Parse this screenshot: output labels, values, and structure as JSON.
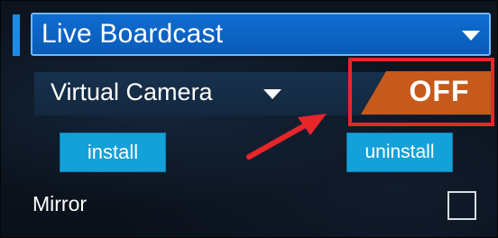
{
  "header": {
    "title": "Live Boardcast",
    "dropdown_icon": "chevron-down-icon"
  },
  "virtual_camera": {
    "label": "Virtual Camera",
    "dropdown_icon": "chevron-down-icon",
    "toggle": {
      "state": "OFF",
      "color": "#c55a1c"
    }
  },
  "annotation": {
    "highlight_color": "#e8262a",
    "arrow_color": "#e8262a"
  },
  "buttons": {
    "install": "install",
    "uninstall": "uninstall"
  },
  "mirror": {
    "label": "Mirror",
    "checked": false
  }
}
